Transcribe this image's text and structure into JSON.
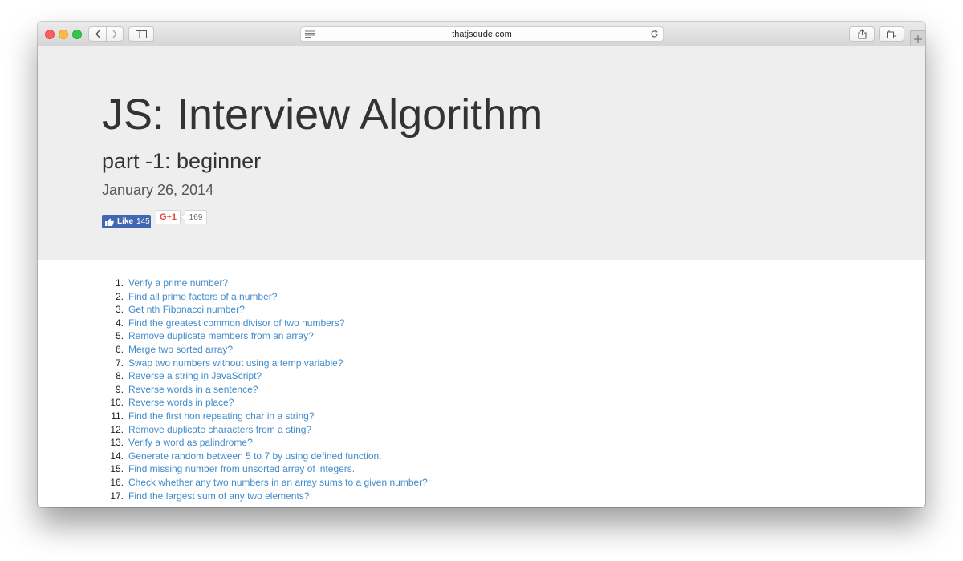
{
  "browser": {
    "url": "thatjsdude.com",
    "icons": {
      "back": "chevron-left-icon",
      "forward": "chevron-right-icon",
      "sidebar": "sidebar-icon",
      "reader": "reader-icon",
      "reload": "reload-icon",
      "share": "share-icon",
      "tabs": "tabs-icon",
      "new_tab": "plus-icon"
    }
  },
  "article": {
    "title": "JS: Interview Algorithm",
    "subtitle": "part -1: beginner",
    "date": "January 26, 2014"
  },
  "social": {
    "like_label": "Like",
    "like_count": "145",
    "gplus_label": "G+1",
    "gplus_count": "169",
    "colors": {
      "facebook": "#4267b2",
      "gplus": "#dd4b39"
    }
  },
  "questions": [
    {
      "num": "1.",
      "text": "Verify a prime number?"
    },
    {
      "num": "2.",
      "text": "Find all prime factors of a number?"
    },
    {
      "num": "3.",
      "text": "Get nth Fibonacci number?"
    },
    {
      "num": "4.",
      "text": "Find the greatest common divisor of two numbers?"
    },
    {
      "num": "5.",
      "text": "Remove duplicate members from an array?"
    },
    {
      "num": "6.",
      "text": "Merge two sorted array?"
    },
    {
      "num": "7.",
      "text": "Swap two numbers without using a temp variable?"
    },
    {
      "num": "8.",
      "text": "Reverse a string in JavaScript?"
    },
    {
      "num": "9.",
      "text": "Reverse words in a sentence?"
    },
    {
      "num": "10.",
      "text": "Reverse words in place?"
    },
    {
      "num": "11.",
      "text": "Find the first non repeating char in a string?"
    },
    {
      "num": "12.",
      "text": "Remove duplicate characters from a sting?"
    },
    {
      "num": "13.",
      "text": "Verify a word as palindrome?"
    },
    {
      "num": "14.",
      "text": "Generate random between 5 to 7 by using defined function."
    },
    {
      "num": "15.",
      "text": "Find missing number from unsorted array of integers."
    },
    {
      "num": "16.",
      "text": "Check whether any two numbers in an array sums to a given number?"
    },
    {
      "num": "17.",
      "text": "Find the largest sum of any two elements?"
    }
  ],
  "colors": {
    "link": "#428bca",
    "hero_bg": "#eeeeee",
    "heading": "#333333"
  }
}
